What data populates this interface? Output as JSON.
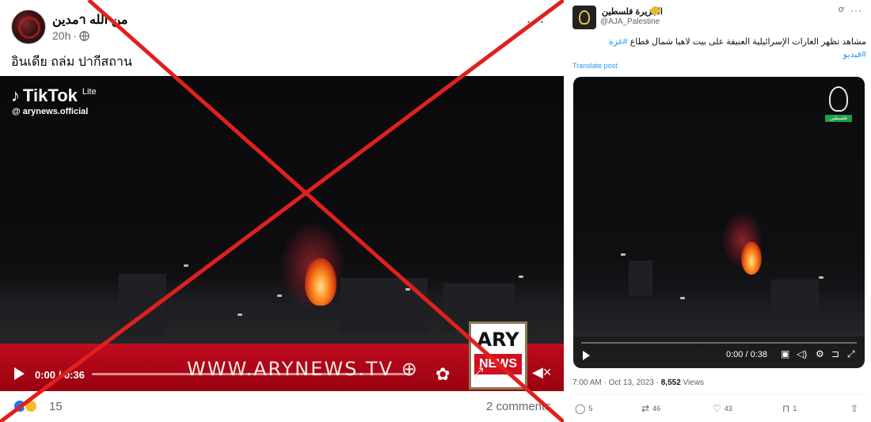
{
  "facebook_post": {
    "author": "مدينา من الله",
    "time": "20h",
    "separator": "·",
    "more": "···",
    "text": "อินเดีย ถล่ม ปากีสถาน",
    "video": {
      "tiktok_note": "♪",
      "tiktok_brand": "TikTok",
      "tiktok_lite": "Lite",
      "tiktok_handle": "@ arynews.official",
      "banner_url": "WWW.ARYNEWS.TV ⊕",
      "ary_logo_top": "ARY",
      "ary_logo_bottom": "NEWS",
      "time": "0:00 / 0:36",
      "settings_icon": "✿",
      "expand_icon": "⤢",
      "volume_icon": "◀×"
    },
    "reaction_count": "15",
    "comments": "2 comments"
  },
  "x_post": {
    "name": "الجزيرة فلسطين",
    "handle": "@AJA_Palestine",
    "grok_icon": "ơ",
    "more": "···",
    "text_main": "مشاهد تظهر الغارات الإسرائيلية العنيفة على بيت لاهيا شمال قطاع ",
    "hashtag_1": "#غزة",
    "hashtag_2": "#فيديو",
    "translate": "Translate post",
    "ajl_label": "فلسطين",
    "video_time": "0:00 / 0:38",
    "timestamp": "7:00 AM · Oct 13, 2023 · ",
    "views_count": "8,552",
    "views_label": " Views",
    "replies": "5",
    "reposts": "46",
    "likes": "43",
    "bookmarks": "1"
  },
  "colors": {
    "cross_red": "#e0201e",
    "fb_blue": "#1877f2",
    "x_link": "#1d9bf0",
    "ary_red": "#d01020"
  }
}
